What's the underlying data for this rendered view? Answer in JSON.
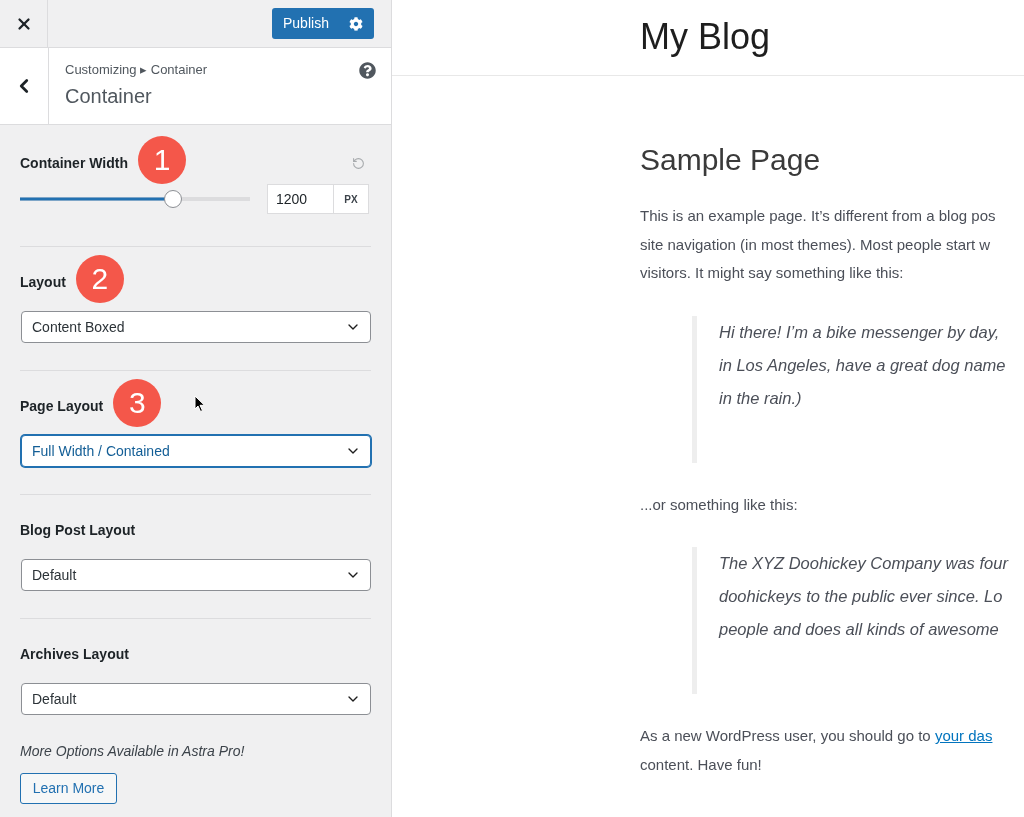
{
  "customizer": {
    "publish_button": "Publish",
    "breadcrumb": "Customizing ▸ Container",
    "section_title": "Container",
    "controls": [
      {
        "kind": "slider",
        "label": "Container Width",
        "marker": "1",
        "level": 0.665,
        "value": "1200",
        "unit": "PX"
      },
      {
        "kind": "select",
        "label": "Layout",
        "marker": "2",
        "value": "Content Boxed",
        "focused": false
      },
      {
        "kind": "select",
        "label": "Page Layout",
        "marker": "3",
        "value": "Full Width / Contained",
        "focused": true
      },
      {
        "kind": "select",
        "label": "Blog Post Layout",
        "value": "Default",
        "focused": false
      },
      {
        "kind": "select",
        "label": "Archives Layout",
        "value": "Default",
        "focused": false
      }
    ],
    "promo": {
      "text": "More Options Available in Astra Pro!",
      "button": "Learn More"
    }
  },
  "preview": {
    "site_title": "My Blog",
    "page_title": "Sample Page",
    "content": [
      {
        "kind": "paragraph",
        "lines": [
          {
            "text": "This is an example page. It’s different from a blog pos"
          },
          {
            "text": "site navigation (in most themes). Most people start w"
          },
          {
            "text": "visitors. It might say something like this:"
          }
        ]
      },
      {
        "kind": "quote",
        "lines": [
          {
            "text": "Hi there! I’m a bike messenger by day,"
          },
          {
            "text": "in Los Angeles, have a great dog name"
          },
          {
            "text": "in the rain.)"
          }
        ]
      },
      {
        "kind": "paragraph",
        "lines": [
          {
            "text": "...or something like this:"
          }
        ]
      },
      {
        "kind": "quote",
        "lines": [
          {
            "text": "The XYZ Doohickey Company was four"
          },
          {
            "text": "doohickeys to the public ever since. Lo"
          },
          {
            "text": "people and does all kinds of awesome"
          }
        ]
      },
      {
        "kind": "paragraph",
        "lines": [
          {
            "text": "As a new WordPress user, you should go to",
            "link": "your das"
          },
          {
            "text": "content. Have fun!"
          }
        ]
      }
    ]
  }
}
